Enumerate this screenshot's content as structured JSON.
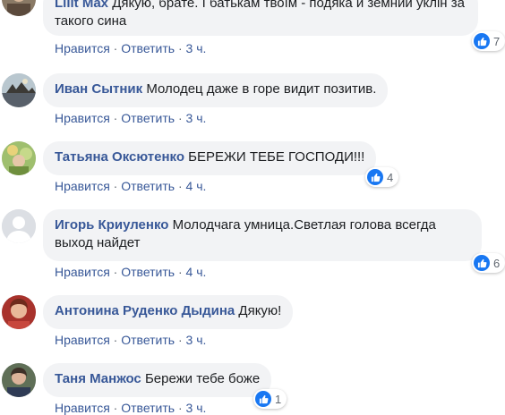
{
  "colors": {
    "author": "#385898",
    "bubble": "#f2f3f5",
    "meta": "#606770",
    "like": "#1877f2"
  },
  "comments": [
    {
      "author": "Lilit Max",
      "text": "Дякую, брате. І батькам твоїм - подяка и земний уклін за такого сина",
      "like_label": "Нравится",
      "reply_label": "Ответить",
      "time": "3 ч.",
      "reactions": "7",
      "reaction_icon": "like-icon"
    },
    {
      "author": "Иван Сытник",
      "text": "Молодец даже в горе видит позитив.",
      "like_label": "Нравится",
      "reply_label": "Ответить",
      "time": "3 ч."
    },
    {
      "author": "Татьяна Оксютенко",
      "text": "БЕРЕЖИ ТЕБЕ ГОСПОДИ!!!",
      "like_label": "Нравится",
      "reply_label": "Ответить",
      "time": "4 ч.",
      "reactions": "4",
      "reaction_icon": "like-icon"
    },
    {
      "author": "Игорь Криуленко",
      "text": "Молодчага умница.Светлая голова всегда выход найдет",
      "like_label": "Нравится",
      "reply_label": "Ответить",
      "time": "4 ч.",
      "reactions": "6",
      "reaction_icon": "like-icon"
    },
    {
      "author": "Антонина Руденко Дыдина",
      "text": "Дякую!",
      "like_label": "Нравится",
      "reply_label": "Ответить",
      "time": "3 ч."
    },
    {
      "author": "Таня Манжос",
      "text": "Бережи тебе боже",
      "like_label": "Нравится",
      "reply_label": "Ответить",
      "time": "3 ч.",
      "reactions": "1",
      "reaction_icon": "like-icon"
    }
  ]
}
